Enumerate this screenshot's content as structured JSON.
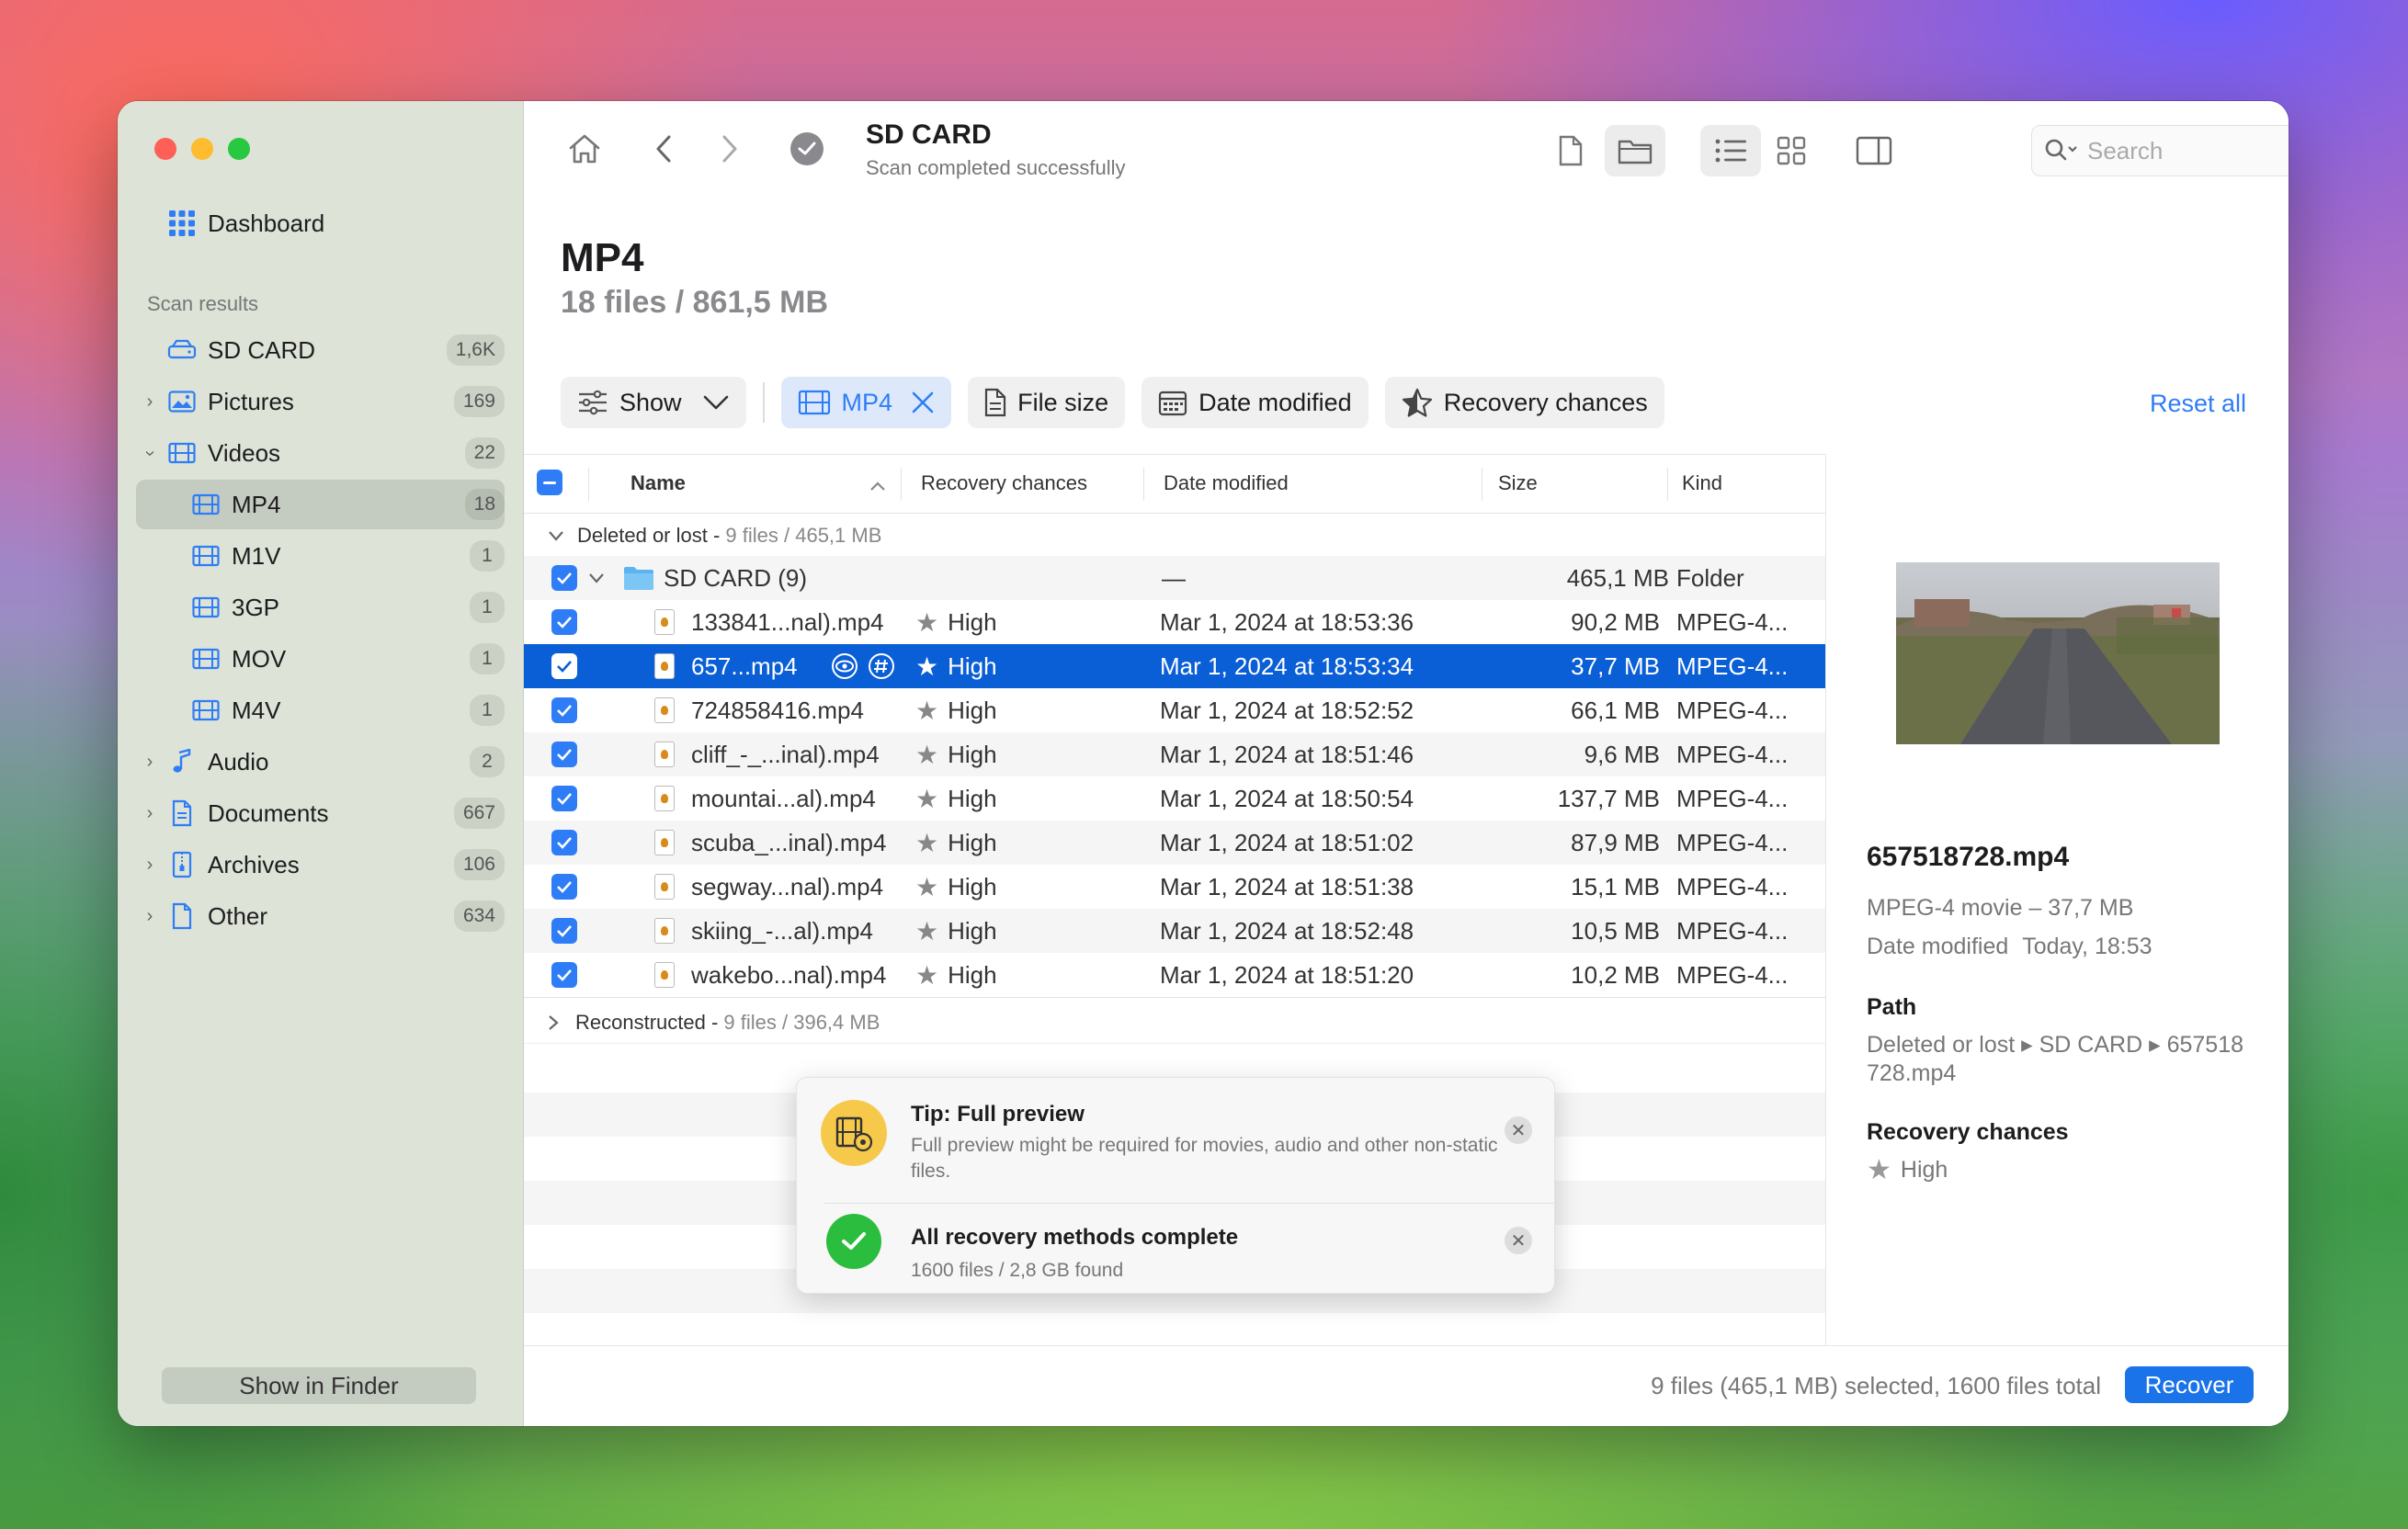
{
  "sidebar": {
    "dashboard_label": "Dashboard",
    "section_label": "Scan results",
    "items": [
      {
        "label": "SD CARD",
        "count": "1,6K"
      },
      {
        "label": "Pictures",
        "count": "169"
      },
      {
        "label": "Videos",
        "count": "22"
      },
      {
        "label": "MP4",
        "count": "18"
      },
      {
        "label": "M1V",
        "count": "1"
      },
      {
        "label": "3GP",
        "count": "1"
      },
      {
        "label": "MOV",
        "count": "1"
      },
      {
        "label": "M4V",
        "count": "1"
      },
      {
        "label": "Audio",
        "count": "2"
      },
      {
        "label": "Documents",
        "count": "667"
      },
      {
        "label": "Archives",
        "count": "106"
      },
      {
        "label": "Other",
        "count": "634"
      }
    ],
    "show_in_finder": "Show in Finder"
  },
  "toolbar": {
    "title": "SD CARD",
    "subtitle": "Scan completed successfully",
    "search_placeholder": "Search"
  },
  "page": {
    "title": "MP4",
    "subtitle": "18 files / 861,5 MB"
  },
  "filters": {
    "show": "Show",
    "mp4": "MP4",
    "file_size": "File size",
    "date_modified": "Date modified",
    "recovery_chances": "Recovery chances",
    "reset_all": "Reset all"
  },
  "table": {
    "headers": {
      "name": "Name",
      "recovery": "Recovery chances",
      "date": "Date modified",
      "size": "Size",
      "kind": "Kind"
    },
    "group1": {
      "label": "Deleted or lost",
      "meta": "9 files / 465,1 MB"
    },
    "folder": {
      "name": "SD CARD (9)",
      "date": "—",
      "size": "465,1 MB",
      "kind": "Folder"
    },
    "rows": [
      {
        "name": "133841...nal).mp4",
        "recovery": "High",
        "date": "Mar 1, 2024 at 18:53:36",
        "size": "90,2 MB",
        "kind": "MPEG-4..."
      },
      {
        "name": "657...mp4",
        "recovery": "High",
        "date": "Mar 1, 2024 at 18:53:34",
        "size": "37,7 MB",
        "kind": "MPEG-4..."
      },
      {
        "name": "724858416.mp4",
        "recovery": "High",
        "date": "Mar 1, 2024 at 18:52:52",
        "size": "66,1 MB",
        "kind": "MPEG-4..."
      },
      {
        "name": "cliff_-_...inal).mp4",
        "recovery": "High",
        "date": "Mar 1, 2024 at 18:51:46",
        "size": "9,6 MB",
        "kind": "MPEG-4..."
      },
      {
        "name": "mountai...al).mp4",
        "recovery": "High",
        "date": "Mar 1, 2024 at 18:50:54",
        "size": "137,7 MB",
        "kind": "MPEG-4..."
      },
      {
        "name": "scuba_...inal).mp4",
        "recovery": "High",
        "date": "Mar 1, 2024 at 18:51:02",
        "size": "87,9 MB",
        "kind": "MPEG-4..."
      },
      {
        "name": "segway...nal).mp4",
        "recovery": "High",
        "date": "Mar 1, 2024 at 18:51:38",
        "size": "15,1 MB",
        "kind": "MPEG-4..."
      },
      {
        "name": "skiing_-...al).mp4",
        "recovery": "High",
        "date": "Mar 1, 2024 at 18:52:48",
        "size": "10,5 MB",
        "kind": "MPEG-4..."
      },
      {
        "name": "wakebo...nal).mp4",
        "recovery": "High",
        "date": "Mar 1, 2024 at 18:51:20",
        "size": "10,2 MB",
        "kind": "MPEG-4..."
      }
    ],
    "group2": {
      "label": "Reconstructed",
      "meta": "9 files / 396,4 MB"
    }
  },
  "toast": {
    "tip_title": "Tip: Full preview",
    "tip_body": "Full preview might be required for movies, audio and other non-static files.",
    "done_title": "All recovery methods complete",
    "done_body": "1600 files / 2,8 GB found"
  },
  "preview": {
    "filename": "657518728.mp4",
    "kind_size": "MPEG-4 movie – 37,7 MB",
    "date_label": "Date modified",
    "date_value": "Today, 18:53",
    "path_label": "Path",
    "path_value_1": "Deleted or lost ▸ SD CARD ▸ 657518",
    "path_value_2": "728.mp4",
    "recovery_label": "Recovery chances",
    "recovery_value": "High"
  },
  "footer": {
    "status": "9 files (465,1 MB) selected, 1600 files total",
    "recover": "Recover"
  }
}
